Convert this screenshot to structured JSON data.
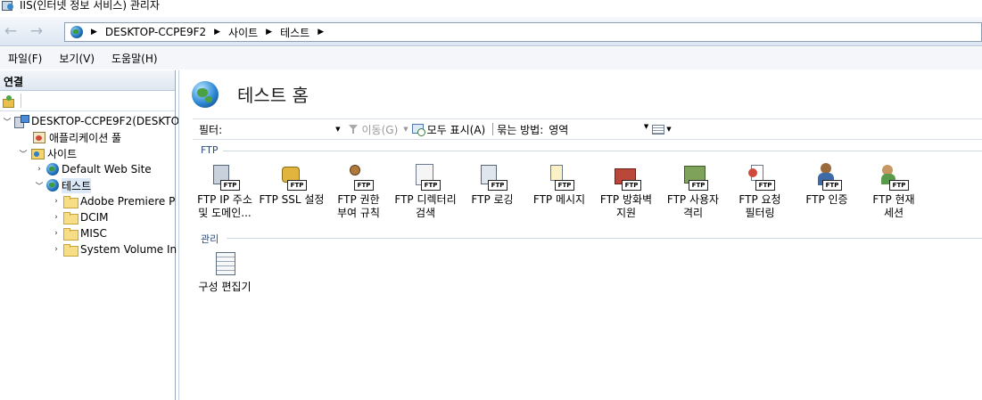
{
  "window": {
    "title": "IIS(인터넷 정보 서비스) 관리자"
  },
  "address": {
    "back": "←",
    "forward": "→",
    "crumbs": [
      "DESKTOP-CCPE9F2",
      "사이트",
      "테스트"
    ],
    "sep": "▶"
  },
  "menu": {
    "items": [
      "파일(F)",
      "보기(V)",
      "도움말(H)"
    ]
  },
  "left": {
    "header": "연결",
    "tree": [
      {
        "label": "DESKTOP-CCPE9F2(DESKTOI",
        "toggle": "﹀",
        "icon": "server-icon"
      },
      {
        "label": "애플리케이션 풀",
        "toggle": "",
        "icon": "app-pool-icon"
      },
      {
        "label": "사이트",
        "toggle": "﹀",
        "icon": "sites-icon"
      },
      {
        "label": "Default Web Site",
        "toggle": "›",
        "icon": "globe-icon"
      },
      {
        "label": "테스트",
        "toggle": "﹀",
        "icon": "globe-icon"
      },
      {
        "label": "Adobe Premiere P",
        "toggle": "›",
        "icon": "folder-icon"
      },
      {
        "label": "DCIM",
        "toggle": "›",
        "icon": "folder-icon"
      },
      {
        "label": "MISC",
        "toggle": "›",
        "icon": "folder-icon"
      },
      {
        "label": "System Volume In",
        "toggle": "›",
        "icon": "folder-icon"
      }
    ]
  },
  "main": {
    "title": "테스트 홈",
    "filter": {
      "label": "필터:",
      "go": "이동(G)",
      "show_all": "모두 표시(A)",
      "group_by_label": "묶는 방법:",
      "group_by_value": "영역",
      "arrow": "▼"
    },
    "groups": [
      {
        "name": "FTP",
        "features": [
          {
            "line1": "FTP IP 주소",
            "line2": "및 도메인...",
            "icon": "ftp-ip-icon"
          },
          {
            "line1": "FTP SSL 설정",
            "line2": "",
            "icon": "ftp-ssl-icon"
          },
          {
            "line1": "FTP 권한",
            "line2": "부여 규칙",
            "icon": "ftp-authorization-icon"
          },
          {
            "line1": "FTP 디렉터리",
            "line2": "검색",
            "icon": "ftp-directory-browsing-icon"
          },
          {
            "line1": "FTP 로깅",
            "line2": "",
            "icon": "ftp-logging-icon"
          },
          {
            "line1": "FTP 메시지",
            "line2": "",
            "icon": "ftp-messages-icon"
          },
          {
            "line1": "FTP 방화벽",
            "line2": "지원",
            "icon": "ftp-firewall-icon"
          },
          {
            "line1": "FTP 사용자",
            "line2": "격리",
            "icon": "ftp-user-isolation-icon"
          },
          {
            "line1": "FTP 요청",
            "line2": "필터링",
            "icon": "ftp-request-filtering-icon"
          },
          {
            "line1": "FTP 인증",
            "line2": "",
            "icon": "ftp-authentication-icon"
          },
          {
            "line1": "FTP 현재",
            "line2": "세션",
            "icon": "ftp-current-sessions-icon"
          }
        ],
        "badge": "FTP"
      },
      {
        "name": "관리",
        "features": [
          {
            "line1": "구성 편집기",
            "line2": "",
            "icon": "configuration-editor-icon"
          }
        ]
      }
    ]
  }
}
